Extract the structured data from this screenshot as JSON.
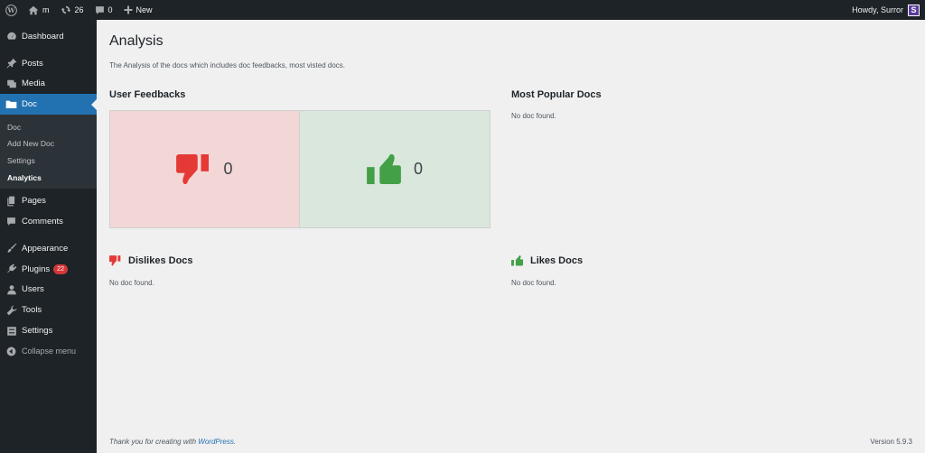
{
  "adminbar": {
    "site_name": "m",
    "updates_count": "26",
    "comments_count": "0",
    "new_label": "New",
    "howdy": "Howdy, Surror",
    "avatar_letter": "S"
  },
  "sidebar": {
    "dashboard": "Dashboard",
    "posts": "Posts",
    "media": "Media",
    "doc": "Doc",
    "sub": [
      "Doc",
      "Add New Doc",
      "Settings",
      "Analytics"
    ],
    "pages": "Pages",
    "comments": "Comments",
    "appearance": "Appearance",
    "plugins": "Plugins",
    "plugins_badge": "22",
    "users": "Users",
    "tools": "Tools",
    "settings": "Settings",
    "collapse": "Collapse menu"
  },
  "main": {
    "title": "Analysis",
    "description": "The Analysis of the docs which includes doc feedbacks, most visted docs.",
    "user_feedbacks": {
      "title": "User Feedbacks",
      "dislikes": "0",
      "likes": "0"
    },
    "most_popular": {
      "title": "Most Popular Docs",
      "empty": "No doc found."
    },
    "dislikes_docs": {
      "title": "Dislikes Docs",
      "empty": "No doc found."
    },
    "likes_docs": {
      "title": "Likes Docs",
      "empty": "No doc found."
    }
  },
  "colors": {
    "dislike": "#e53935",
    "like": "#43a047",
    "accent": "#2271b1"
  },
  "footer": {
    "thanks_prefix": "Thank you for creating with ",
    "wordpress_link": "WordPress",
    "thanks_suffix": ".",
    "version": "Version 5.9.3"
  }
}
